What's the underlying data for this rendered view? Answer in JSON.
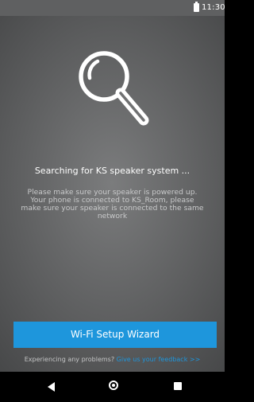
{
  "status_bar": {
    "time": "11:30",
    "battery_icon": "battery-full-icon"
  },
  "main": {
    "icon": "magnifier-icon",
    "title": "Searching for KS speaker system ...",
    "instructions": "Please make sure your speaker is powered up. Your phone is connected to KS_Room, please make sure your speaker is connected to the same network",
    "wizard_button_label": "Wi-Fi Setup Wizard",
    "problem_text": "Experiencing any problems?",
    "feedback_link_text": "Give us your feedback >>"
  },
  "nav_bar": {
    "back_icon": "back-triangle-icon",
    "home_icon": "home-circle-icon",
    "recents_icon": "recents-square-icon"
  },
  "colors": {
    "accent": "#1e96dc",
    "status_bar": "#5f6061",
    "background_center": "#7b7c7d",
    "background_edge": "#464748",
    "nav_bar": "#000000"
  }
}
